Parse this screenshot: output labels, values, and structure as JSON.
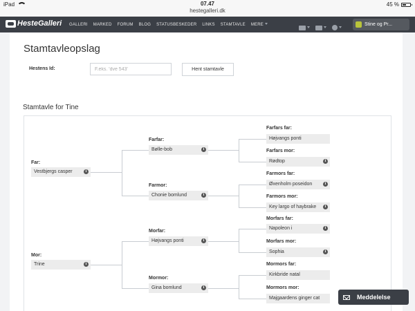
{
  "status_bar": {
    "device": "iPad",
    "time": "07.47",
    "url": "hestegalleri.dk",
    "battery": "45 %"
  },
  "nav": {
    "logo": "HesteGalleri",
    "items": [
      "GALLERI",
      "MARKED",
      "FORUM",
      "BLOG",
      "STATUSBESKEDER",
      "LINKS",
      "STAMTAVLE",
      "MERE"
    ],
    "user": "Stine og Pr..."
  },
  "page": {
    "title": "Stamtavleopslag",
    "field_label": "Hestens Id:",
    "field_placeholder": "F.eks. 'dve 543'",
    "button": "Hent stamtavle",
    "section_title": "Stamtavle for Tine"
  },
  "pedigree": {
    "far": {
      "label": "Far:",
      "name": "Vestbjergs casper"
    },
    "mor": {
      "label": "Mor:",
      "name": "Trine"
    },
    "farfar": {
      "label": "Farfar:",
      "name": "Bølle-bob"
    },
    "farmor": {
      "label": "Farmor:",
      "name": "Chonie bomlund"
    },
    "morfar": {
      "label": "Morfar:",
      "name": "Højvangs ponti"
    },
    "mormor": {
      "label": "Mormor:",
      "name": "Gina bomlund"
    },
    "farfars_far": {
      "label": "Farfars far:",
      "name": "Højvangs ponti"
    },
    "farfars_mor": {
      "label": "Farfars mor:",
      "name": "Rødtop"
    },
    "farmors_far": {
      "label": "Farmors far:",
      "name": "Øxenholm poseidon"
    },
    "farmors_mor": {
      "label": "Farmors mor:",
      "name": "Key largo of haybrake"
    },
    "morfars_far": {
      "label": "Morfars far:",
      "name": "Napoleon i"
    },
    "morfars_mor": {
      "label": "Morfars mor:",
      "name": "Sophia"
    },
    "mormors_far": {
      "label": "Mormors far:",
      "name": "Kirkbride natal"
    },
    "mormors_mor": {
      "label": "Mormors mor:",
      "name": "Majgaardens ginger cat"
    },
    "info_glyph": "i"
  },
  "chat": {
    "label": "Meddelelse"
  }
}
